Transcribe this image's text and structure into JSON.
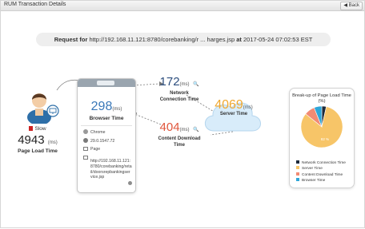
{
  "window": {
    "title": "RUM Transaction Details",
    "back_label": "Back"
  },
  "request": {
    "prefix": "Request for",
    "url": "http://192.168.11.121:8780/corebanking/r ... harges.jsp",
    "at": "at",
    "timestamp": "2017-05-24 07:02:53 EST"
  },
  "page": {
    "status": "Slow",
    "value": "4943",
    "unit": "(ms)",
    "label": "Page Load Time"
  },
  "browser": {
    "value": "298",
    "unit": "(ms)",
    "label": "Browser Time",
    "name": "Chrome",
    "version": "29.0.1547.72",
    "type": "Page",
    "url": "http://192.168.11.121:8780/corebanking/retail/doorsrepbankingservice.jsp"
  },
  "network": {
    "value": "172",
    "unit": "(ms)",
    "label": "Network Connection Time"
  },
  "server": {
    "value": "4069",
    "unit": "(ms)",
    "label": "Server Time"
  },
  "content": {
    "value": "404",
    "unit": "(ms)",
    "label": "Content Download Time"
  },
  "breakup": {
    "title": "Break-up of Page Load Time (%)",
    "center_label": "82 %",
    "colors": {
      "network": "#1e2a3a",
      "server": "#f7c568",
      "content": "#f28b74",
      "browser": "#2ea6d8"
    },
    "slices": [
      {
        "name": "Network Connection Time",
        "percent": 3.5,
        "color": "#1e2a3a"
      },
      {
        "name": "Server Time",
        "percent": 82.3,
        "color": "#f7c568"
      },
      {
        "name": "Content Download Time",
        "percent": 8.2,
        "color": "#f28b74"
      },
      {
        "name": "Browser Time",
        "percent": 6.0,
        "color": "#2ea6d8"
      }
    ],
    "legend": [
      "Network Connection Time",
      "Server Time",
      "Content Download Time",
      "Browser Time"
    ]
  }
}
